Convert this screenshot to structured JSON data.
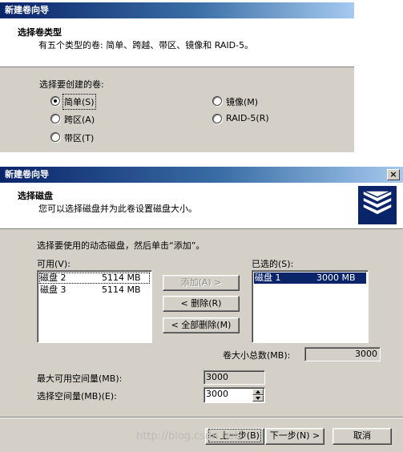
{
  "dialog1": {
    "title": "新建卷向导",
    "header_title": "选择卷类型",
    "header_subtitle": "有五个类型的卷: 简单、跨越、带区、镜像和 RAID-5。",
    "group_label": "选择要创建的卷:",
    "options": [
      {
        "label": "简单(S)",
        "checked": true
      },
      {
        "label": "跨区(A)",
        "checked": false
      },
      {
        "label": "带区(T)",
        "checked": false
      },
      {
        "label": "镜像(M)",
        "checked": false
      },
      {
        "label": "RAID-5(R)",
        "checked": false
      }
    ]
  },
  "dialog2": {
    "title": "新建卷向导",
    "close_glyph": "×",
    "header_title": "选择磁盘",
    "header_subtitle": "您可以选择磁盘并为此卷设置磁盘大小。",
    "instruction": "选择要使用的动态磁盘，然后单击“添加”。",
    "available_label": "可用(V):",
    "available": [
      {
        "name": "磁盘 2",
        "size": "5114 MB"
      },
      {
        "name": "磁盘 3",
        "size": "5114 MB"
      }
    ],
    "selected_label": "已选的(S):",
    "selected": [
      {
        "name": "磁盘 1",
        "size": "3000 MB"
      }
    ],
    "add_label": "添加(A) >",
    "remove_label": "< 删除(R)",
    "remove_all_label": "< 全部删除(M)",
    "total_label": "卷大小总数(MB):",
    "total_value": "3000",
    "max_label": "最大可用空间量(MB):",
    "max_value": "3000",
    "amount_label": "选择空间量(MB)(E):",
    "amount_value": "3000",
    "back_label": "< 上一步(B)",
    "next_label": "下一步(N) >",
    "cancel_label": "取消"
  },
  "watermark": "http://blog.csdn.net/"
}
